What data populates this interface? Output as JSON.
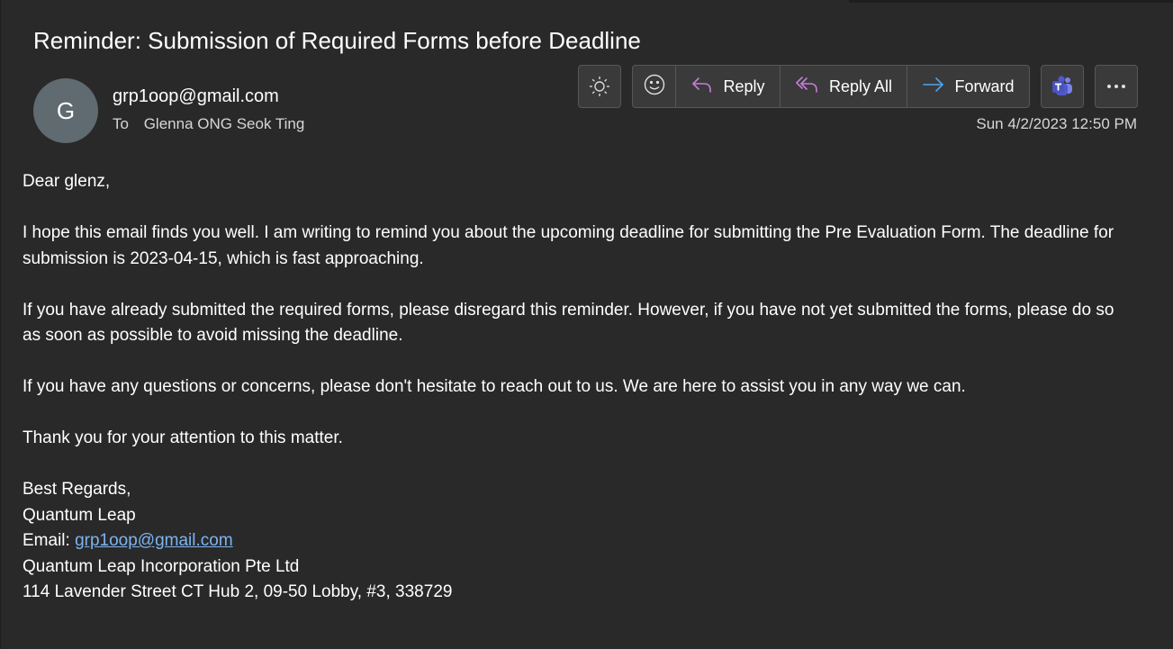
{
  "email": {
    "subject": "Reminder: Submission of Required Forms before Deadline",
    "avatar_initial": "G",
    "sender": "grp1oop@gmail.com",
    "to_label": "To",
    "recipient": "Glenna ONG Seok Ting",
    "date": "Sun 4/2/2023 12:50 PM"
  },
  "toolbar": {
    "brightness_icon": "sun-icon",
    "emoji_icon": "smiley-icon",
    "reply_label": "Reply",
    "reply_all_label": "Reply All",
    "forward_label": "Forward",
    "teams_icon": "teams-icon",
    "more_icon": "more-icon"
  },
  "body": {
    "greeting": "Dear glenz,",
    "paragraph1": "I hope this email finds you well. I am writing to remind you about the upcoming deadline for submitting the Pre Evaluation Form. The deadline for submission is 2023-04-15, which is fast approaching.",
    "paragraph2": "If you have already submitted the required forms, please disregard this reminder. However, if you have not yet submitted the forms, please do so as soon as possible to avoid missing the deadline.",
    "paragraph3": "If you have any questions or concerns, please don't hesitate to reach out to us. We are here to assist you in any way we can.",
    "paragraph4": "Thank you for your attention to this matter.",
    "signature": {
      "closing": "Best Regards,",
      "name": "Quantum Leap",
      "email_label": "Email: ",
      "email_link": "grp1oop@gmail.com",
      "company": "Quantum Leap Incorporation Pte Ltd",
      "address": "114 Lavender Street CT Hub 2, 09-50 Lobby, #3, 338729"
    }
  },
  "colors": {
    "background": "#292929",
    "button_bg": "#3a3a3a",
    "reply_icon": "#c77dd8",
    "forward_icon": "#4aa3f0",
    "teams_icon": "#6264a7",
    "link": "#7eb4f0"
  }
}
